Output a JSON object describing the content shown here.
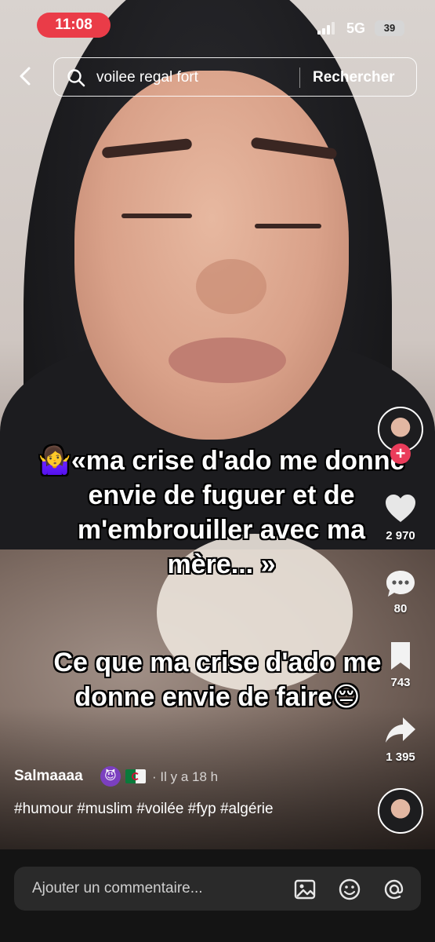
{
  "status_bar": {
    "time": "11:08",
    "network": "5G",
    "battery": "39"
  },
  "search": {
    "query": "voilee regal fort",
    "button_label": "Rechercher"
  },
  "video": {
    "overlay_line1": "🤷‍♀️«ma crise d'ado me donne envie de fuguer et de m'embrouiller avec ma mère... »",
    "overlay_line2": "Ce que ma crise d'ado me donne envie de faire😔"
  },
  "actions": {
    "likes": "2 970",
    "comments": "80",
    "saves": "743",
    "shares": "1 395",
    "follow_symbol": "+"
  },
  "post": {
    "author": "Salmaaaa",
    "author_emoji": "😈",
    "time_ago": "· Il y a 18 h",
    "hashtags": "#humour #muslim #voilée #fyp #algérie"
  },
  "comment_bar": {
    "placeholder": "Ajouter un commentaire..."
  },
  "icons": {
    "back": "chevron-left-icon",
    "search": "search-icon",
    "like": "heart-icon",
    "comment": "comment-icon",
    "save": "bookmark-icon",
    "share": "share-icon",
    "image": "image-icon",
    "emoji": "emoji-icon",
    "mention": "at-icon"
  },
  "colors": {
    "accent": "#ea3c48",
    "follow": "#ea3c5a"
  }
}
